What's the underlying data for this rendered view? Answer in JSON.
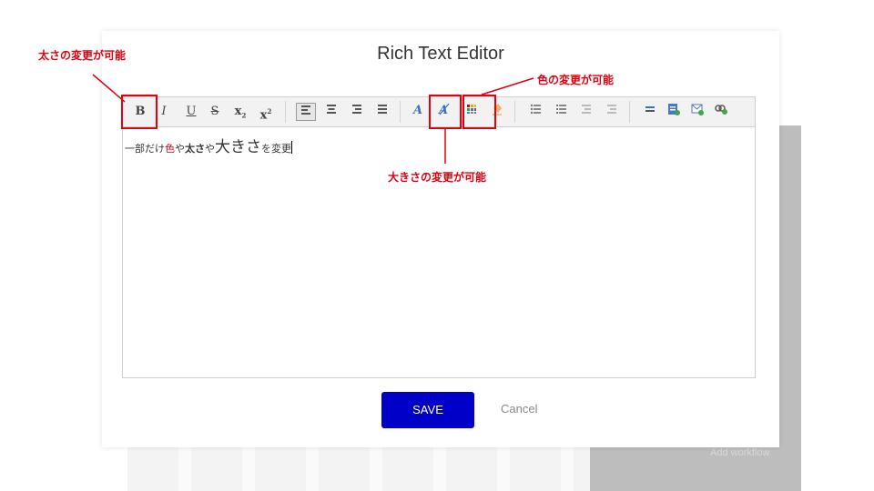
{
  "background": {
    "label": "Add workflow"
  },
  "modal": {
    "title": "Rich Text Editor",
    "save_label": "SAVE",
    "cancel_label": "Cancel"
  },
  "toolbar": {
    "bold": "B",
    "italic": "I",
    "underline": "U",
    "strikethrough": "S",
    "subscript": "x",
    "superscript": "x"
  },
  "editor": {
    "segments": [
      {
        "text": "一部だけ",
        "style": "plain"
      },
      {
        "text": "色",
        "style": "red"
      },
      {
        "text": "や",
        "style": "plain"
      },
      {
        "text": "太さ",
        "style": "bold"
      },
      {
        "text": "や",
        "style": "plain"
      },
      {
        "text": "大きさ",
        "style": "big"
      },
      {
        "text": "を変更",
        "style": "plain"
      }
    ]
  },
  "annotations": {
    "bold": "太さの変更が可能",
    "color": "色の変更が可能",
    "size": "大きさの変更が可能"
  },
  "colors": {
    "accent": "#e3000f",
    "save": "#0000c8"
  }
}
